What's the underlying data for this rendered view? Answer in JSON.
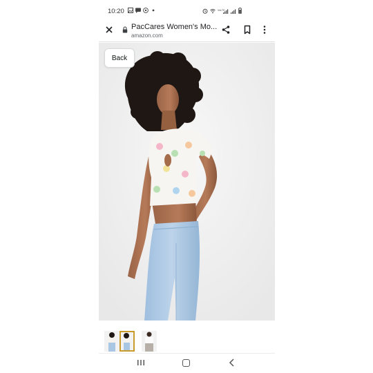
{
  "status_bar": {
    "time": "10:20",
    "left_icons": [
      "gallery-icon",
      "message-icon",
      "whatsapp-icon",
      "dot-icon"
    ],
    "right_icons": [
      "alarm-icon",
      "wifi-icon",
      "volte-signal-icon",
      "signal-icon",
      "battery-icon"
    ],
    "network_label": "VoLTE"
  },
  "toolbar": {
    "title": "PacCares Women's Mo...",
    "url": "amazon.com",
    "icons": [
      "close-icon",
      "lock-icon",
      "share-icon",
      "bookmark-icon",
      "more-vert-icon"
    ]
  },
  "product": {
    "back_label": "Back",
    "image_alt": "model",
    "colors": {
      "top_base": "#f7f5f1",
      "jeans": "#a9c6e3",
      "background": "#f1f1f1"
    }
  },
  "thumbnails": {
    "count": 3,
    "selected_index": 1,
    "selected_border": "#c89b2a"
  },
  "nav_bar": {
    "icons": [
      "recents-icon",
      "home-icon",
      "back-icon"
    ]
  }
}
